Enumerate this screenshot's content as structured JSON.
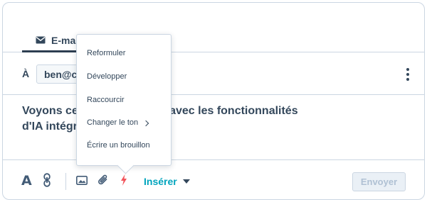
{
  "tabs": {
    "email_label": "E-mail"
  },
  "recipient": {
    "label": "À",
    "value": "ben@cor"
  },
  "body": {
    "text": "Voyons ce qu'on peut faire avec les fonctionnalités d'IA intégrées."
  },
  "ai_menu": {
    "items": [
      {
        "label": "Reformuler"
      },
      {
        "label": "Développer"
      },
      {
        "label": "Raccourcir"
      },
      {
        "label": "Changer le ton",
        "has_submenu": true
      },
      {
        "label": "Écrire un brouillon"
      }
    ]
  },
  "toolbar": {
    "font_glyph": "A",
    "insert_label": "Insérer",
    "send_label": "Envoyer"
  },
  "icons": [
    "envelope-icon",
    "kebab-icon",
    "text-style-icon",
    "link-icon",
    "image-icon",
    "attachment-icon",
    "ai-lightning-icon",
    "caret-down-icon",
    "chevron-right-icon"
  ],
  "colors": {
    "text": "#33475b",
    "border": "#cbd6e2",
    "accent_teal": "#00a4bd",
    "ai_red": "#f2545b",
    "disabled_text": "#b0c1d4"
  }
}
